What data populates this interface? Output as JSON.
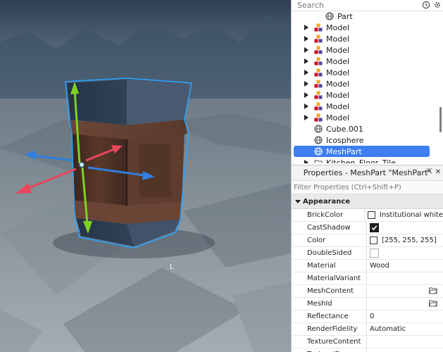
{
  "explorer": {
    "search_placeholder": "Search",
    "items": [
      {
        "label": "Part",
        "icon": "part-icon",
        "expandable": false,
        "indent": 1
      },
      {
        "label": "Model",
        "icon": "model-icon",
        "expandable": true,
        "indent": 0
      },
      {
        "label": "Model",
        "icon": "model-icon",
        "expandable": true,
        "indent": 0
      },
      {
        "label": "Model",
        "icon": "model-icon",
        "expandable": true,
        "indent": 0
      },
      {
        "label": "Model",
        "icon": "model-icon",
        "expandable": true,
        "indent": 0
      },
      {
        "label": "Model",
        "icon": "model-icon",
        "expandable": true,
        "indent": 0
      },
      {
        "label": "Model",
        "icon": "model-icon",
        "expandable": true,
        "indent": 0
      },
      {
        "label": "Model",
        "icon": "model-icon",
        "expandable": true,
        "indent": 0
      },
      {
        "label": "Model",
        "icon": "model-icon",
        "expandable": true,
        "indent": 0
      },
      {
        "label": "Model",
        "icon": "model-icon",
        "expandable": true,
        "indent": 0
      },
      {
        "label": "Cube.001",
        "icon": "meshpart-icon",
        "expandable": false,
        "indent": 0
      },
      {
        "label": "Icosphere",
        "icon": "meshpart-icon",
        "expandable": false,
        "indent": 0
      },
      {
        "label": "MeshPart",
        "icon": "meshpart-icon",
        "expandable": false,
        "indent": 0,
        "selected": true
      },
      {
        "label": "Kitchen_Floor_Tile",
        "icon": "folder-icon",
        "expandable": true,
        "indent": 0
      }
    ]
  },
  "properties": {
    "title": "Properties - MeshPart \"MeshPart\"",
    "filter_placeholder": "Filter Properties (Ctrl+Shift+P)",
    "section": "Appearance",
    "rows": [
      {
        "name": "BrickColor",
        "type": "swatch",
        "value": "Institutional white",
        "color": "#f8f8f8"
      },
      {
        "name": "CastShadow",
        "type": "check",
        "checked": true
      },
      {
        "name": "Color",
        "type": "swatch",
        "value": "[255, 255, 255]",
        "color": "#ffffff"
      },
      {
        "name": "DoubleSided",
        "type": "check",
        "checked": false
      },
      {
        "name": "Material",
        "type": "text",
        "value": "Wood"
      },
      {
        "name": "MaterialVariant",
        "type": "text",
        "value": ""
      },
      {
        "name": "MeshContent",
        "type": "file",
        "value": ""
      },
      {
        "name": "MeshId",
        "type": "file",
        "value": ""
      },
      {
        "name": "Reflectance",
        "type": "text",
        "value": "0"
      },
      {
        "name": "RenderFidelity",
        "type": "text",
        "value": "Automatic"
      },
      {
        "name": "TextureContent",
        "type": "text",
        "value": ""
      },
      {
        "name": "TextureID",
        "type": "text",
        "value": ""
      }
    ]
  },
  "viewport": {
    "cursor_glyph": "L"
  },
  "colors": {
    "selection": "#3d7ff0",
    "axis_y": "#7ed321",
    "axis_x": "#e8475c",
    "axis_z": "#2f7fe0",
    "bounding_box": "#29a3ff"
  }
}
